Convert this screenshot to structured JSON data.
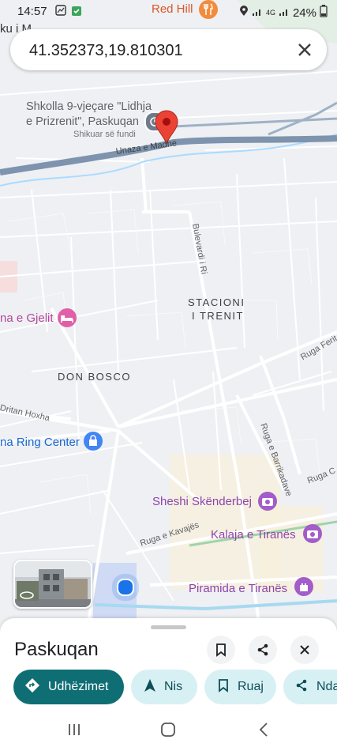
{
  "status_bar": {
    "time": "14:57",
    "battery": "24%",
    "network": "4G"
  },
  "search": {
    "value": "41.352373,19.810301"
  },
  "map": {
    "poi_labels": {
      "school_line1": "Shkolla 9-vjeçare \"Lidhja",
      "school_line2": "e Prizrenit\", Paskuqan",
      "school_status": "Shikuar së fundi",
      "red_hill": "Red Hill",
      "hotel": "na e Gjelit",
      "mall_fragment": "ku i M",
      "ring_center": "na Ring Center",
      "skanderbeg": "Sheshi Skënderbej",
      "kalaja": "Kalaja e Tiranës",
      "piramida": "Piramida e Tiranës"
    },
    "district_labels": {
      "stacioni_line1": "STACIONI",
      "stacioni_line2": "I TRENIT",
      "don_bosco": "DON BOSCO"
    },
    "road_labels": {
      "unaza": "Unaza e Madhe",
      "bulevardi": "Bulevardi i Ri",
      "ruga_ferit": "Ruga Ferit",
      "dritan_hoxha": "Dritan Hoxha",
      "barrikadave": "Ruga e Barrikadave",
      "ruga_c": "Ruga C",
      "kavajes": "Ruga e Kavajës"
    },
    "colors": {
      "accent_teal": "#0f6e74",
      "pin_red": "#ea4335",
      "location_blue": "#1a73e8",
      "poi_purple": "#8e44ad"
    }
  },
  "place_sheet": {
    "title": "Paskuqan",
    "actions": [
      {
        "label": "Udhëzimet",
        "icon": "directions-icon"
      },
      {
        "label": "Nis",
        "icon": "navigation-arrow-icon"
      },
      {
        "label": "Ruaj",
        "icon": "bookmark-icon"
      },
      {
        "label": "Nda",
        "icon": "share-icon"
      }
    ]
  }
}
